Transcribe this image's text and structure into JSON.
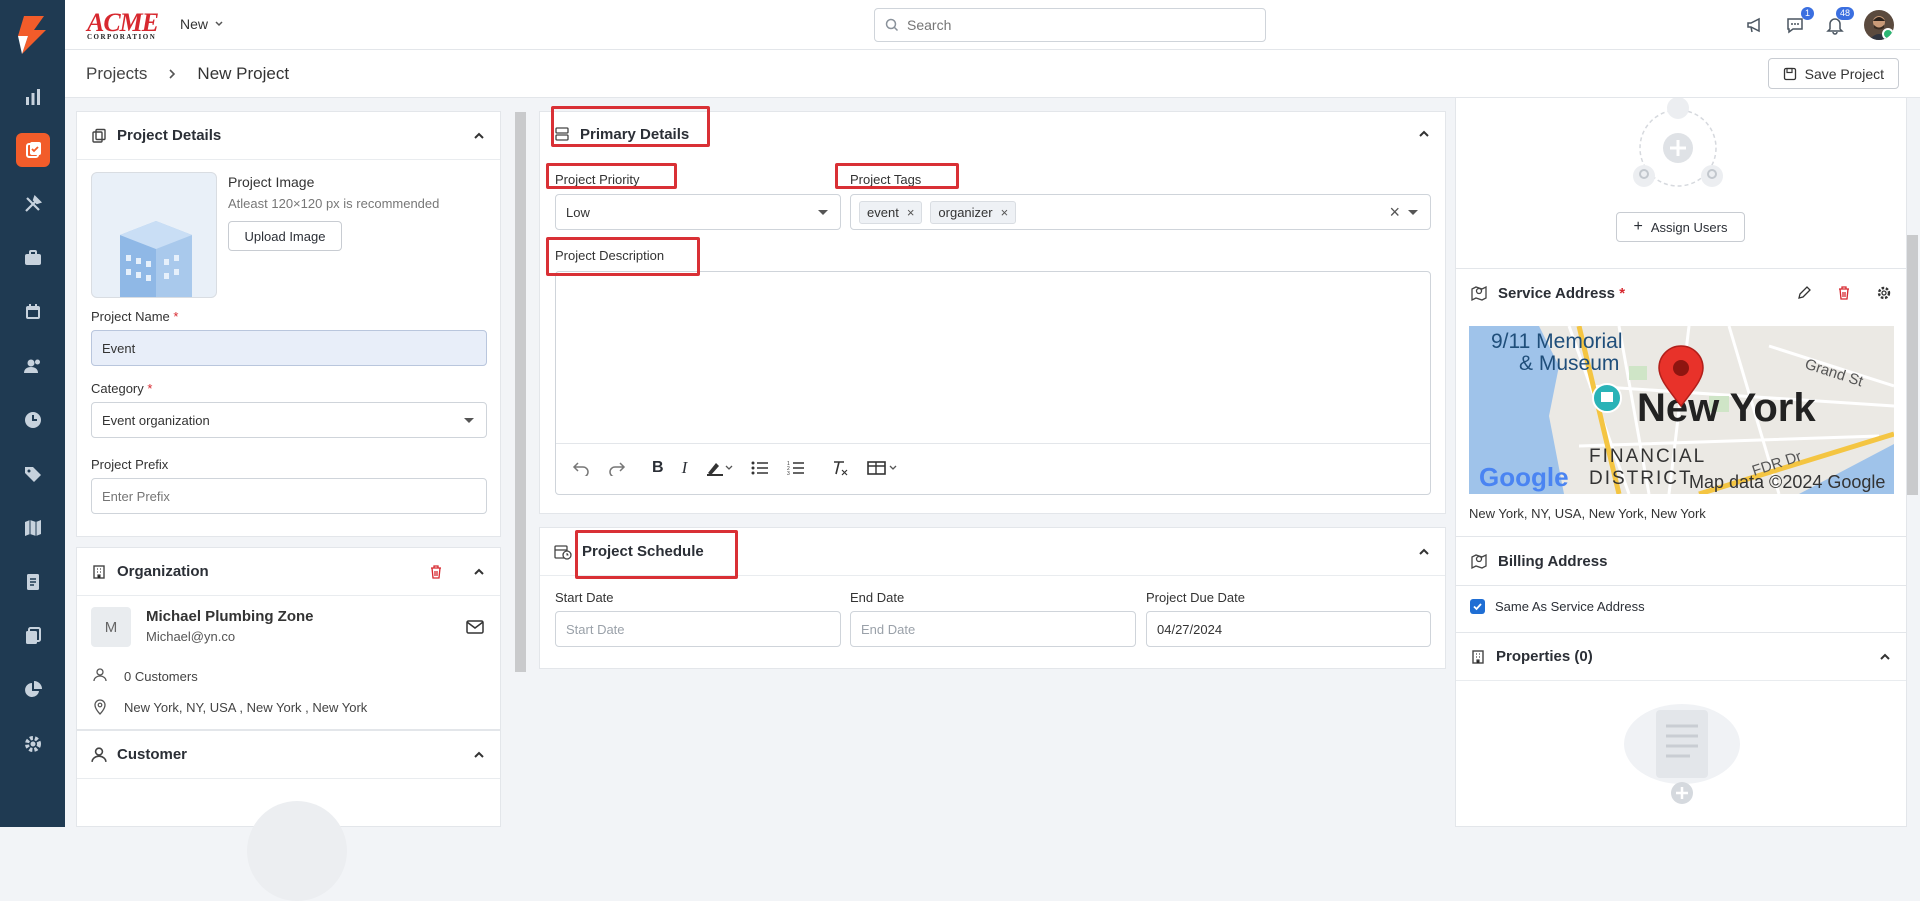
{
  "brand": {
    "line1": "ACME",
    "line2": "CORPORATION"
  },
  "topbar": {
    "new_label": "New",
    "search_placeholder": "Search",
    "messages_badge": "1",
    "notifications_badge": "48"
  },
  "breadcrumb": {
    "root": "Projects",
    "current": "New Project"
  },
  "toolbar": {
    "save_label": "Save Project"
  },
  "project_details": {
    "title": "Project Details",
    "image_label": "Project Image",
    "image_hint": "Atleast 120×120 px is recommended",
    "upload_label": "Upload Image",
    "name_label": "Project Name",
    "name_value": "Event",
    "category_label": "Category",
    "category_value": "Event organization",
    "prefix_label": "Project Prefix",
    "prefix_placeholder": "Enter Prefix",
    "required_mark": "*"
  },
  "organization": {
    "title": "Organization",
    "avatar_letter": "M",
    "name": "Michael Plumbing Zone",
    "email": "Michael@yn.co",
    "customers": "0 Customers",
    "address": "New York, NY, USA , New York , New York"
  },
  "customer": {
    "title": "Customer"
  },
  "primary_details": {
    "title": "Primary Details",
    "priority_label": "Project Priority",
    "priority_value": "Low",
    "tags_label": "Project Tags",
    "tags": [
      "event",
      "organizer"
    ],
    "tag_remove": "×",
    "description_label": "Project Description",
    "clear_icon": "×"
  },
  "schedule": {
    "title": "Project Schedule",
    "start_label": "Start Date",
    "start_placeholder": "Start Date",
    "end_label": "End Date",
    "end_placeholder": "End Date",
    "due_label": "Project Due Date",
    "due_value": "04/27/2024"
  },
  "right": {
    "assign_label": "Assign Users",
    "service_title": "Service Address",
    "required_mark": "*",
    "map": {
      "place1": "9/11 Memorial",
      "place2": "& Museum",
      "city": "New York",
      "district1": "FINANCIAL",
      "district2": "DISTRICT",
      "street1": "Grand St",
      "street2": "FDR Dr",
      "google": "Google",
      "copyright": "Map data ©2024 Google"
    },
    "service_address": "New York, NY, USA, New York, New York",
    "billing_title": "Billing Address",
    "same_as_label": "Same As Service Address",
    "properties_title": "Properties (0)"
  },
  "colors": {
    "nav_bg": "#1f3a52",
    "accent": "#f25c2a",
    "highlight": "#d93035",
    "brand_red": "#d7282f"
  }
}
